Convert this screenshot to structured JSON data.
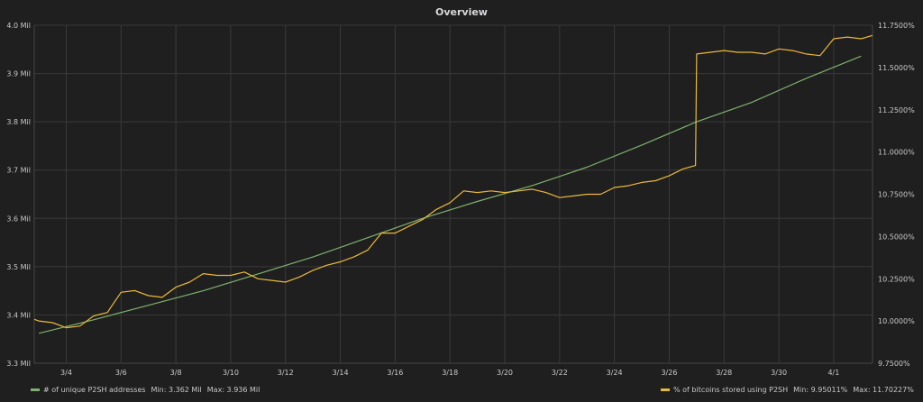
{
  "panel": {
    "title": "Overview"
  },
  "legend": {
    "items": [
      {
        "label": "# of unique P2SH addresses",
        "min_text": "Min: 3.362 Mil",
        "max_text": "Max: 3.936 Mil",
        "color": "#7eb26d"
      },
      {
        "label": "% of bitcoins stored using P2SH",
        "min_text": "Min: 9.95011%",
        "max_text": "Max: 11.70227%",
        "color": "#eab839"
      }
    ]
  },
  "chart_data": {
    "type": "line",
    "title": "Overview",
    "x_range": [
      "3/2 20:00",
      "4/2 10:00"
    ],
    "x_ticks": [
      "3/4",
      "3/6",
      "3/8",
      "3/10",
      "3/12",
      "3/14",
      "3/16",
      "3/18",
      "3/20",
      "3/22",
      "3/24",
      "3/26",
      "3/28",
      "3/30",
      "4/1"
    ],
    "y_left": {
      "min": 3.3,
      "max": 4.0,
      "ticks": [
        "3.3 Mil",
        "3.4 Mil",
        "3.5 Mil",
        "3.6 Mil",
        "3.7 Mil",
        "3.8 Mil",
        "3.9 Mil",
        "4.0 Mil"
      ]
    },
    "y_right": {
      "min": 9.75,
      "max": 11.75,
      "ticks": [
        "9.7500%",
        "10.0000%",
        "10.2500%",
        "10.5000%",
        "10.7500%",
        "11.0000%",
        "11.2500%",
        "11.5000%",
        "11.7500%"
      ]
    },
    "grid": true,
    "legend_position": "bottom",
    "series": [
      {
        "name": "# of unique P2SH addresses",
        "axis": "left",
        "color": "#7eb26d",
        "x": [
          "3/3",
          "3/5",
          "3/7",
          "3/9",
          "3/11",
          "3/13",
          "3/15",
          "3/17",
          "3/19",
          "3/21",
          "3/23",
          "3/25",
          "3/27",
          "3/29",
          "3/31",
          "4/2"
        ],
        "values": [
          3.362,
          3.39,
          3.42,
          3.45,
          3.485,
          3.52,
          3.56,
          3.6,
          3.635,
          3.668,
          3.706,
          3.752,
          3.8,
          3.84,
          3.89,
          3.936
        ]
      },
      {
        "name": "% of bitcoins stored using P2SH",
        "axis": "right",
        "color": "#eab839",
        "x": [
          "3/2 20:00",
          "3/3",
          "3/3 12:00",
          "3/4",
          "3/4 12:00",
          "3/5",
          "3/5 12:00",
          "3/6",
          "3/6 12:00",
          "3/7",
          "3/7 12:00",
          "3/8",
          "3/8 12:00",
          "3/9",
          "3/9 12:00",
          "3/10",
          "3/10 12:00",
          "3/11",
          "3/11 12:00",
          "3/12",
          "3/12 12:00",
          "3/13",
          "3/13 12:00",
          "3/14",
          "3/14 12:00",
          "3/15",
          "3/15 12:00",
          "3/16",
          "3/16 12:00",
          "3/17",
          "3/17 12:00",
          "3/18",
          "3/18 12:00",
          "3/19",
          "3/19 12:00",
          "3/20",
          "3/20 12:00",
          "3/21",
          "3/21 12:00",
          "3/22",
          "3/22 12:00",
          "3/23",
          "3/23 12:00",
          "3/24",
          "3/24 12:00",
          "3/25",
          "3/25 12:00",
          "3/26",
          "3/26 12:00",
          "3/26 23:00",
          "3/27",
          "3/27 12:00",
          "3/28",
          "3/28 12:00",
          "3/29",
          "3/29 12:00",
          "3/30",
          "3/30 12:00",
          "3/31",
          "3/31 12:00",
          "4/1",
          "4/1 12:00",
          "4/2",
          "4/2 10:00"
        ],
        "values": [
          10.01,
          10.0,
          9.99,
          9.96,
          9.97,
          10.03,
          10.05,
          10.17,
          10.18,
          10.15,
          10.14,
          10.2,
          10.23,
          10.28,
          10.27,
          10.27,
          10.29,
          10.25,
          10.24,
          10.23,
          10.26,
          10.3,
          10.33,
          10.35,
          10.38,
          10.42,
          10.52,
          10.52,
          10.56,
          10.6,
          10.66,
          10.7,
          10.77,
          10.76,
          10.77,
          10.76,
          10.77,
          10.78,
          10.76,
          10.73,
          10.74,
          10.75,
          10.75,
          10.79,
          10.8,
          10.82,
          10.83,
          10.86,
          10.9,
          10.92,
          11.58,
          11.59,
          11.6,
          11.59,
          11.59,
          11.58,
          11.61,
          11.6,
          11.58,
          11.57,
          11.67,
          11.68,
          11.67,
          11.69
        ]
      }
    ]
  }
}
